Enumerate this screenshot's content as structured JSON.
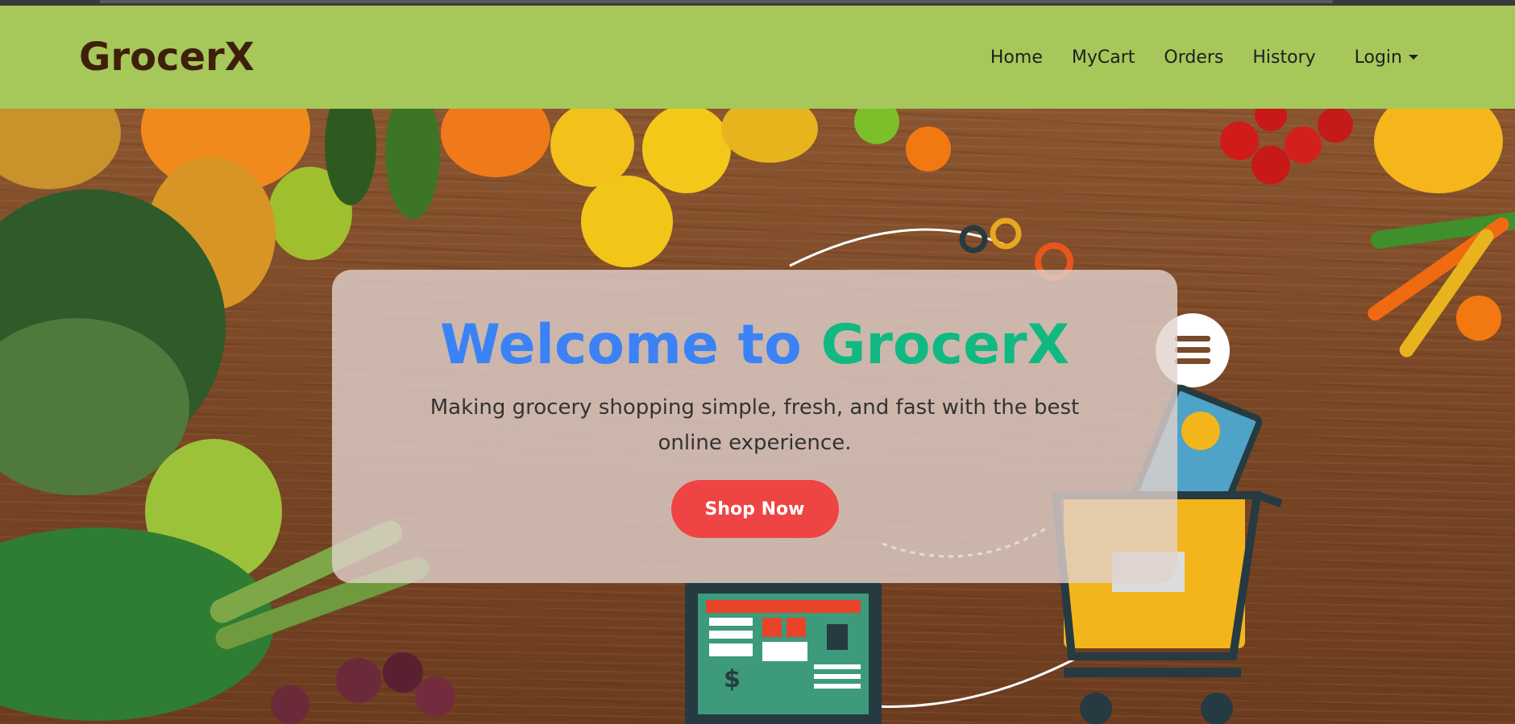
{
  "navbar": {
    "brand": "GrocerX",
    "links": {
      "home": "Home",
      "mycart": "MyCart",
      "orders": "Orders",
      "history": "History",
      "login": "Login"
    }
  },
  "hero": {
    "title_part1": "Welcome to",
    "title_part2": "GrocerX",
    "subtitle": "Making grocery shopping simple, fresh, and fast with the best online experience.",
    "cta_label": "Shop Now"
  },
  "colors": {
    "navbar_bg": "#a6c85a",
    "brand_text": "#3f1f0a",
    "title_blue": "#3b82f6",
    "title_green": "#10b981",
    "cta_bg": "#ef4444",
    "wood_bg": "#7a4726"
  },
  "icons": [
    "caret-down-icon",
    "hamburger-icon",
    "gear-icon",
    "shopping-cart-icon",
    "monitor-icon",
    "dollar-icon",
    "shopping-bag-icon"
  ]
}
